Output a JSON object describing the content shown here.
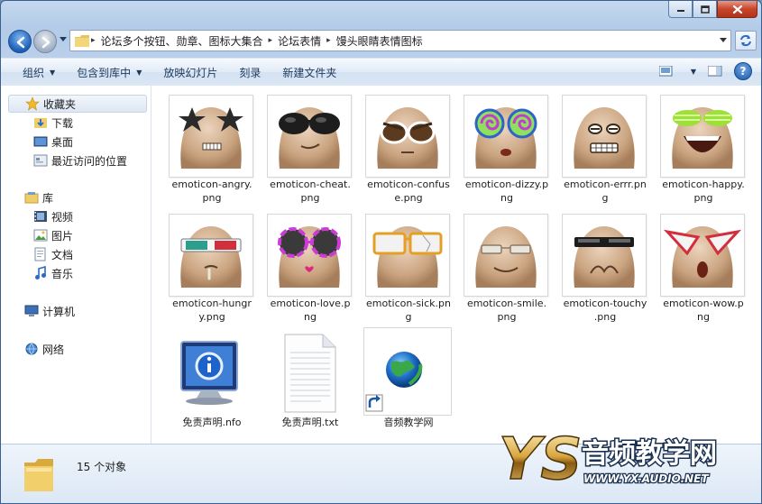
{
  "window": {
    "controls": {
      "minimize": "minimize-icon",
      "maximize": "maximize-icon",
      "close": "close-icon"
    }
  },
  "address": {
    "breadcrumbs": [
      "论坛多个按钮、勋章、图标大集合",
      "论坛表情",
      "馒头眼睛表情图标"
    ]
  },
  "toolbar": {
    "organize": "组织",
    "include_in_library": "包含到库中",
    "slideshow": "放映幻灯片",
    "burn": "刻录",
    "new_folder": "新建文件夹"
  },
  "navigation": {
    "favorites": "收藏夹",
    "downloads": "下载",
    "desktop": "桌面",
    "recent": "最近访问的位置",
    "libraries": "库",
    "videos": "视频",
    "pictures": "图片",
    "documents": "文档",
    "music": "音乐",
    "computer": "计算机",
    "network": "网络"
  },
  "files": [
    {
      "name": "emoticon-angry.png",
      "line1": "emoticon-angry.",
      "line2": "png"
    },
    {
      "name": "emoticon-cheat.png",
      "line1": "emoticon-cheat.",
      "line2": "png"
    },
    {
      "name": "emoticon-confuse.png",
      "line1": "emoticon-confus",
      "line2": "e.png"
    },
    {
      "name": "emoticon-dizzy.png",
      "line1": "emoticon-dizzy.p",
      "line2": "ng"
    },
    {
      "name": "emoticon-errr.png",
      "line1": "emoticon-errr.pn",
      "line2": "g"
    },
    {
      "name": "emoticon-happy.png",
      "line1": "emoticon-happy.",
      "line2": "png"
    },
    {
      "name": "emoticon-hungry.png",
      "line1": "emoticon-hungr",
      "line2": "y.png"
    },
    {
      "name": "emoticon-love.png",
      "line1": "emoticon-love.p",
      "line2": "ng"
    },
    {
      "name": "emoticon-sick.png",
      "line1": "emoticon-sick.pn",
      "line2": "g"
    },
    {
      "name": "emoticon-smile.png",
      "line1": "emoticon-smile.",
      "line2": "png"
    },
    {
      "name": "emoticon-touchy.png",
      "line1": "emoticon-touchy",
      "line2": ".png"
    },
    {
      "name": "emoticon-wow.png",
      "line1": "emoticon-wow.p",
      "line2": "ng"
    },
    {
      "name": "免责声明.nfo",
      "line1": "免责声明.nfo",
      "line2": ""
    },
    {
      "name": "免责声明.txt",
      "line1": "免责声明.txt",
      "line2": ""
    },
    {
      "name": "音频教学网",
      "line1": "音频教学网",
      "line2": ""
    }
  ],
  "status": {
    "count": "15 个对象"
  },
  "watermark": {
    "logo": "YS",
    "title": "音频教学网",
    "url": "WWW.YX-AUDIO.NET"
  },
  "colors": {
    "accent": "#1c5fb8",
    "face": "#d8b89a",
    "face_shade": "#b88e6a"
  }
}
